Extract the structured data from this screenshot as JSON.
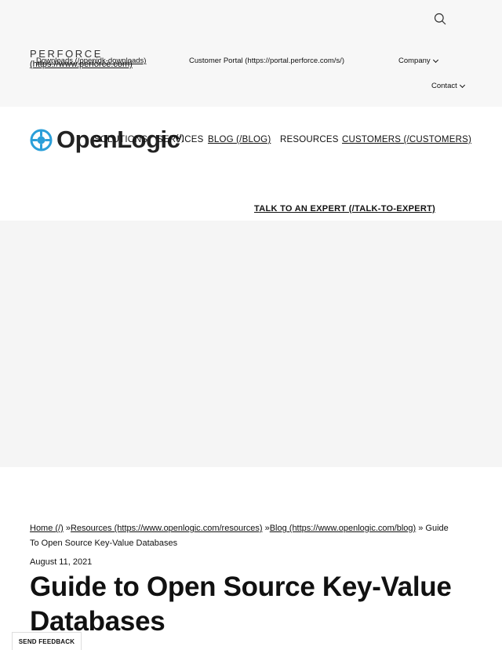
{
  "utility_bar": {
    "perforce_logo": "PERFORCE",
    "perforce_link": "(https://www.perforce.com)",
    "downloads": "Downloads (/openjdk-downloads)",
    "customer_portal": "Customer Portal (https://portal.perforce.com/s/)",
    "company": "Company",
    "contact": "Contact",
    "search_icon": "search-icon"
  },
  "main_nav": {
    "logo_text": "OpenLogic",
    "logo_link": "(/)",
    "solutions": "SOLUTIONS",
    "services": "SERVICES",
    "blog": "BLOG (/BLOG)",
    "resources": "RESOURCES",
    "customers": "CUSTOMERS (/CUSTOMERS)",
    "cta": "TALK TO AN EXPERT (/TALK-TO-EXPERT)"
  },
  "breadcrumb": {
    "home": "Home (/)",
    "sep": "»",
    "resources": "Resources (https://www.openlogic.com/resources)",
    "blog": "Blog (https://www.openlogic.com/blog)",
    "current": "» Guide To Open Source Key-Value Databases"
  },
  "article": {
    "date": "August 11, 2021",
    "title": "Guide to Open Source Key-Value Databases"
  },
  "feedback_button": "SEND FEEDBACK",
  "colors": {
    "top_band": "#f7f7f7",
    "logo_blue": "#2b9fd9",
    "text": "#111111"
  }
}
